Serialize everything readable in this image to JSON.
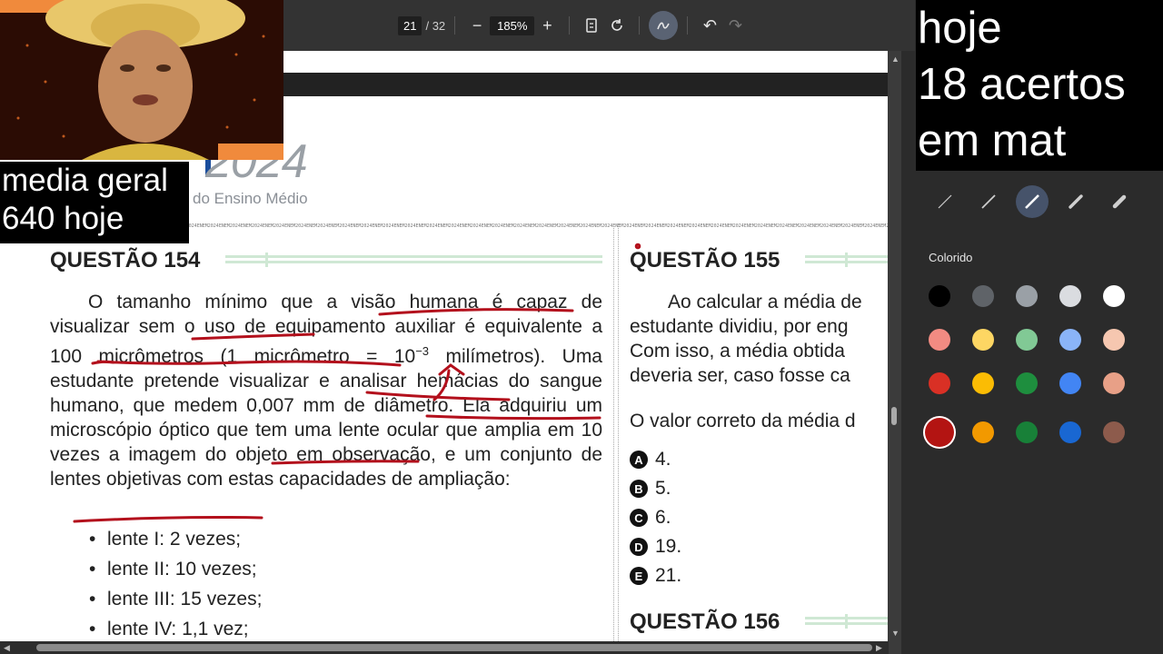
{
  "toolbar": {
    "page_current": "21",
    "page_total": "/ 32",
    "zoom": "185%",
    "zoom_out": "−",
    "zoom_in": "+",
    "undo": "↶",
    "redo": "↷"
  },
  "document": {
    "logo_year": "2024",
    "logo_subtitle": "do Ensino Médio",
    "strip_text": "ENEM2024ENEM2024ENEM2024ENEM2024ENEM2024ENEM2024ENEM2024ENEM2024ENEM2024ENEM2024ENEM2024ENEM2024ENEM2024ENEM2024ENEM2024ENEM2024ENEM2024ENEM2024ENEM2024ENEM2024ENEM2024ENEM2024ENEM2024ENEM2024ENEM2024ENEM2024ENEM2024ENEM2024ENEM2024ENEM2024ENEM2024ENEM2024ENEM2024ENEM2024ENEM2024ENEM2024ENEM2024ENEM2024ENEM2024ENEM2024ENEM2024ENEM2024ENEM2024ENEM2024ENEM2024ENEM2024",
    "q154": {
      "title": "QUESTÃO 154",
      "text_part1": "O tamanho mínimo que a visão humana é capaz de visualizar sem o uso de equipamento auxiliar é equivalente a 100 micrômetros (1 micrômetro = 10",
      "superscript": "−3",
      "text_part2": " milímetros). Uma estudante pretende visualizar e analisar hemácias do sangue humano, que medem 0,007 mm de diâmetro. Ela adquiriu um microscópio óptico que tem uma lente ocular que amplia em 10 vezes a imagem do objeto em observação, e um conjunto de lentes objetivas com estas capacidades de ampliação:",
      "lenses": [
        "lente I: 2 vezes;",
        "lente II: 10 vezes;",
        "lente III: 15 vezes;",
        "lente IV: 1,1 vez;"
      ]
    },
    "q155": {
      "title": "QUESTÃO 155",
      "lines": [
        "Ao calcular a média de",
        "estudante dividiu, por eng",
        "Com isso, a média obtida",
        "deveria ser, caso fosse ca"
      ],
      "prompt": "O valor correto da média d",
      "options": [
        {
          "letter": "A",
          "value": "4."
        },
        {
          "letter": "B",
          "value": "5."
        },
        {
          "letter": "C",
          "value": "6."
        },
        {
          "letter": "D",
          "value": "19."
        },
        {
          "letter": "E",
          "value": "21."
        }
      ]
    },
    "q156": {
      "title": "QUESTÃO 156"
    }
  },
  "panel": {
    "label": "Colorido",
    "swatches": [
      [
        "#000000",
        "#5f6368",
        "#9aa0a6",
        "#dadce0",
        "#ffffff"
      ],
      [
        "#f28b82",
        "#fdd663",
        "#81c995",
        "#8ab4f8",
        "#f6c7b0"
      ],
      [
        "#d93025",
        "#fbbc04",
        "#1e8e3e",
        "#4285f4",
        "#e8a087"
      ],
      [
        "#b31412",
        "#f29900",
        "#188038",
        "#1967d2",
        "#8d5b4c"
      ]
    ]
  },
  "overlays": {
    "left_line1": "media geral",
    "left_line2": "640 hoje",
    "right_line1": "hoje",
    "right_line2": "18 acertos",
    "right_line3": "em mat"
  }
}
